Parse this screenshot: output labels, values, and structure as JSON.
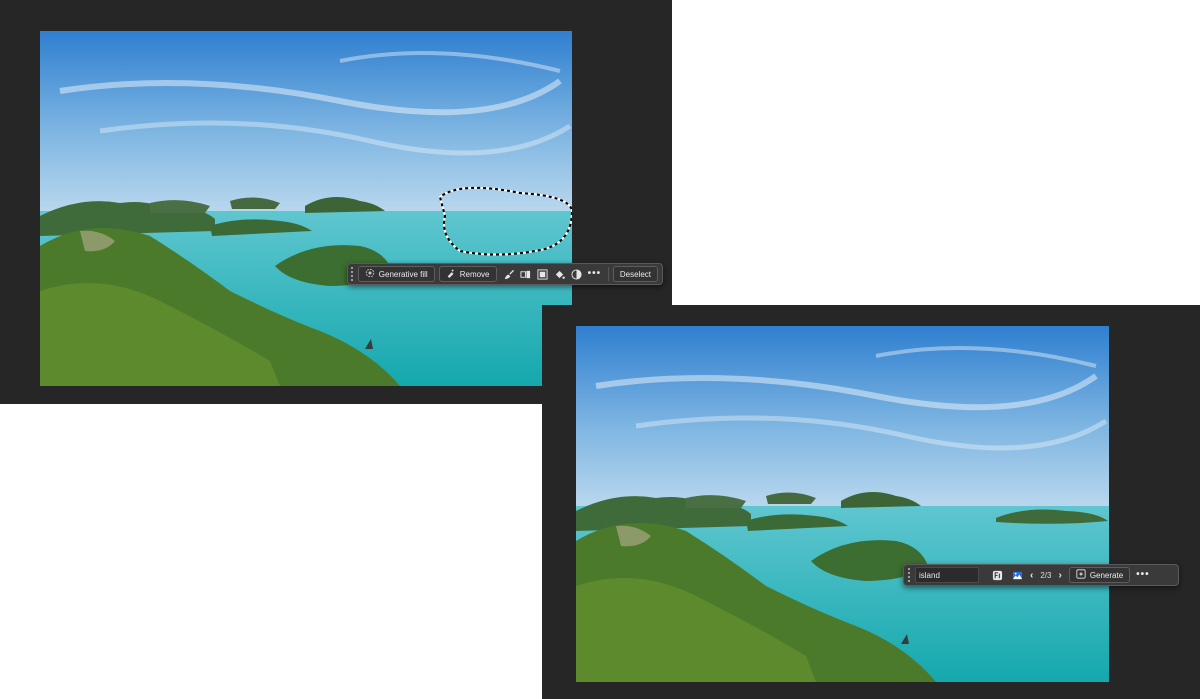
{
  "colors": {
    "panel_bg": "#262626",
    "toolbar_bg": "#3a3a3a",
    "sky_top": "#2f7fd0",
    "sea": "#1fb3b8"
  },
  "top_toolbar": {
    "items": [
      {
        "label": "Generative fill",
        "icon": "generative-fill-icon"
      },
      {
        "label": "Remove",
        "icon": "remove-brush-icon"
      },
      {
        "icon": "brush-icon"
      },
      {
        "icon": "transform-icon"
      },
      {
        "icon": "mask-icon"
      },
      {
        "icon": "fill-bucket-icon"
      },
      {
        "icon": "adjustment-icon"
      },
      {
        "icon": "more-icon"
      },
      {
        "label": "Deselect"
      }
    ]
  },
  "bottom_toolbar": {
    "prompt_value": "island",
    "pager": "2/3",
    "generate_label": "Generate",
    "icons": [
      "firefly-icon",
      "reference-image-icon",
      "chevron-left-icon",
      "chevron-right-icon",
      "generate-icon",
      "more-icon"
    ]
  }
}
